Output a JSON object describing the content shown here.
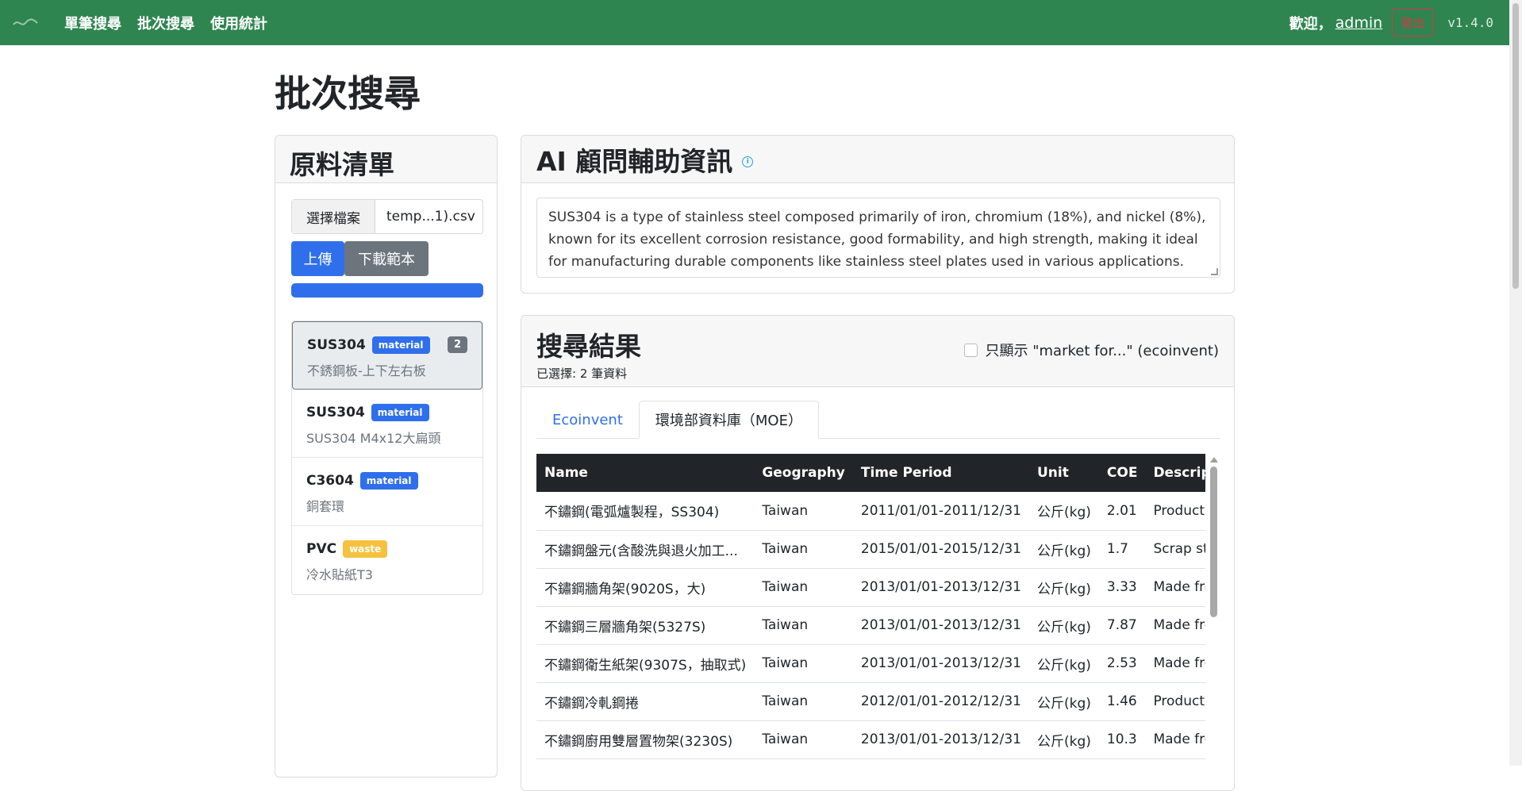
{
  "nav": {
    "links": [
      "單筆搜尋",
      "批次搜尋",
      "使用統計"
    ],
    "welcome": "歡迎，",
    "user": "admin",
    "logout": "登出",
    "version": "v1.4.0"
  },
  "page": {
    "title": "批次搜尋"
  },
  "materials_panel": {
    "title": "原料清單",
    "file_button": "選擇檔案",
    "file_name": "temp...1).csv",
    "upload": "上傳",
    "download_template": "下載範本",
    "progress": 1.0,
    "items": [
      {
        "name": "SUS304",
        "tag": "material",
        "desc": "不銹鋼板-上下左右板",
        "count": "2",
        "active": true
      },
      {
        "name": "SUS304",
        "tag": "material",
        "desc": "SUS304 M4x12大扁頭"
      },
      {
        "name": "C3604",
        "tag": "material",
        "desc": "銅套環"
      },
      {
        "name": "PVC",
        "tag": "waste",
        "desc": "冷水貼紙T3"
      }
    ]
  },
  "ai_panel": {
    "title": "AI 顧問輔助資訊",
    "text": "SUS304 is a type of stainless steel composed primarily of iron, chromium (18%), and nickel (8%), known for its excellent corrosion resistance, good formability, and high strength, making it ideal for manufacturing durable components like stainless steel plates used in various applications."
  },
  "results": {
    "title": "搜尋結果",
    "selected": "已選擇: 2 筆資料",
    "filter_label": "只顯示 \"market for...\" (ecoinvent)",
    "tabs": [
      "Ecoinvent",
      "環境部資料庫（MOE）"
    ],
    "active_tab": 1,
    "columns": [
      "Name",
      "Geography",
      "Time Period",
      "Unit",
      "COE",
      "Description"
    ],
    "rows": [
      [
        "不鏽鋼(電弧爐製程，SS304)",
        "Taiwan",
        "2011/01/01-2011/12/31",
        "公斤(kg)",
        "2.01",
        "Production"
      ],
      [
        "不鏽鋼盤元(含酸洗與退火加工...",
        "Taiwan",
        "2015/01/01-2015/12/31",
        "公斤(kg)",
        "1.7",
        "Scrap steel"
      ],
      [
        "不鏽鋼牆角架(9020S，大)",
        "Taiwan",
        "2013/01/01-2013/12/31",
        "公斤(kg)",
        "3.33",
        "Made from"
      ],
      [
        "不鏽鋼三層牆角架(5327S)",
        "Taiwan",
        "2013/01/01-2013/12/31",
        "公斤(kg)",
        "7.87",
        "Made from"
      ],
      [
        "不鏽鋼衛生紙架(9307S，抽取式)",
        "Taiwan",
        "2013/01/01-2013/12/31",
        "公斤(kg)",
        "2.53",
        "Made from"
      ],
      [
        "不鏽鋼冷軋鋼捲",
        "Taiwan",
        "2012/01/01-2012/12/31",
        "公斤(kg)",
        "1.46",
        "Production"
      ],
      [
        "不鏽鋼廚用雙層置物架(3230S)",
        "Taiwan",
        "2013/01/01-2013/12/31",
        "公斤(kg)",
        "10.3",
        "Made from"
      ]
    ]
  },
  "colors": {
    "navbar": "#2e8550",
    "primary": "#2f6fec",
    "secondary": "#6c757d",
    "warning": "#f6c13e",
    "danger": "#dc3545"
  }
}
